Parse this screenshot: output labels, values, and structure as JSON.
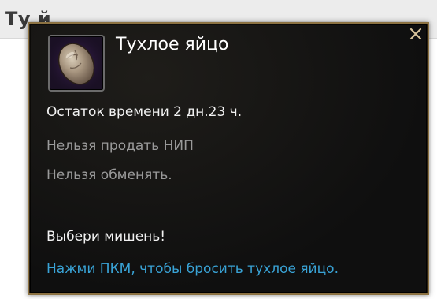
{
  "page": {
    "title": "Ту          й"
  },
  "tooltip": {
    "close_icon": "close-x-icon",
    "item_icon": "rotten-egg-icon",
    "item_name": "Тухлое яйцо",
    "remaining_time": "Остаток времени 2 дн.23 ч.",
    "cannot_sell": "Нельзя продать НИП",
    "cannot_trade": "Нельзя обменять.",
    "choose_target": "Выбери мишень!",
    "use_hint": "Нажми ПКМ, чтобы бросить тухлое яйцо.",
    "colors": {
      "border": "#8c7242",
      "background": "#0f0f0f",
      "title": "#ffffff",
      "primary_text": "#f2f2f2",
      "muted_text": "#9a9a9a",
      "hint_text": "#39a3d6",
      "close_icon": "#d8c39a"
    }
  }
}
